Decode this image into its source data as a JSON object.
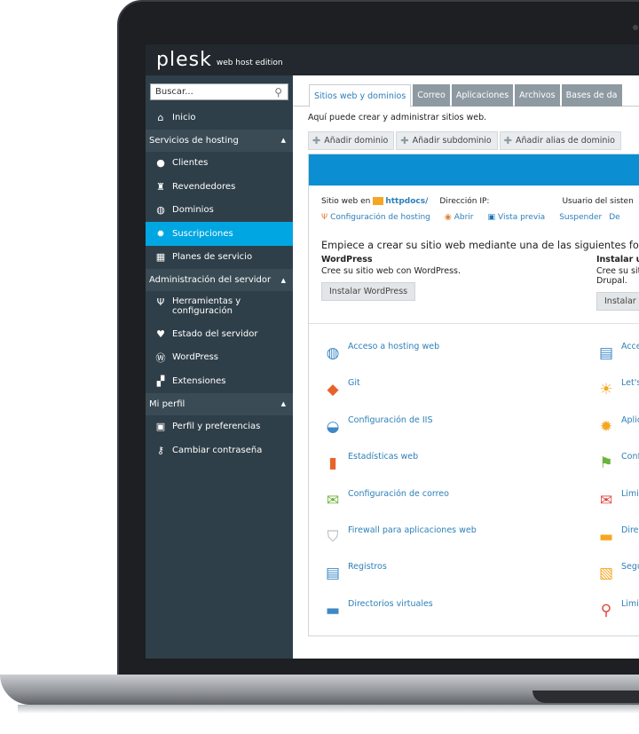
{
  "header": {
    "logo": "plesk",
    "edition": "web host edition"
  },
  "sidebar": {
    "search_placeholder": "Buscar...",
    "home": "Inicio",
    "sections": {
      "hosting": "Servicios de hosting",
      "admin": "Administración del servidor",
      "profile": "Mi perfil"
    },
    "hosting_items": [
      "Clientes",
      "Revendedores",
      "Dominios",
      "Suscripciones",
      "Planes de servicio"
    ],
    "admin_items": [
      "Herramientas y configuración",
      "Estado del servidor",
      "WordPress",
      "Extensiones"
    ],
    "profile_items": [
      "Perfil y preferencias",
      "Cambiar contraseña"
    ]
  },
  "main": {
    "tabs": [
      "Sitios web y dominios",
      "Correo",
      "Aplicaciones",
      "Archivos",
      "Bases de da"
    ],
    "intro": "Aquí puede crear y administrar sitios web.",
    "toolbar": [
      "Añadir dominio",
      "Añadir subdominio",
      "Añadir alias de dominio"
    ],
    "site": {
      "prefix": "Sitio web en",
      "folder": "httpdocs/",
      "ip_label": "Dirección IP:",
      "user_label": "Usuario del sisten"
    },
    "links": [
      "Configuración de hosting",
      "Abrir",
      "Vista previa",
      "Suspender",
      "De"
    ],
    "headline": "Empiece a crear su sitio web mediante una de las siguientes forma",
    "options": {
      "left_title": "WordPress",
      "left_desc": "Cree su sitio web con WordPress.",
      "left_button": "Instalar WordPress",
      "right_title": "Instalar ur",
      "right_desc1": "Cree su sit",
      "right_desc2": "Drupal.",
      "right_button": "Instalar a"
    },
    "tools_left": [
      "Acceso a hosting web",
      "Git",
      "Configuración de IIS",
      "Estadísticas web",
      "Configuración de correo",
      "Firewall para aplicaciones web",
      "Registros",
      "Directorios virtuales"
    ],
    "tools_right": [
      "Acce",
      "Let's",
      "Aplic",
      "Conf",
      "Limit",
      "Direc",
      "Segu",
      "Limit"
    ]
  },
  "colors": {
    "topbar": "#22282e",
    "sidebar": "#2f3f49",
    "active": "#00a6e2",
    "link": "#2d7fb8",
    "card_head": "#0c8fd2"
  }
}
